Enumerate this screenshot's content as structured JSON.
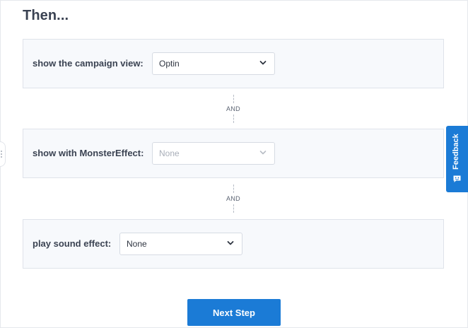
{
  "page": {
    "heading": "Then..."
  },
  "rules": [
    {
      "label": "show the campaign view:",
      "select_value": "Optin",
      "disabled": false
    },
    {
      "label": "show with MonsterEffect:",
      "select_value": "None",
      "disabled": true
    },
    {
      "label": "play sound effect:",
      "select_value": "None",
      "disabled": false
    }
  ],
  "connectors": [
    {
      "label": "AND"
    },
    {
      "label": "AND"
    }
  ],
  "actions": {
    "next_step_label": "Next Step"
  },
  "feedback": {
    "label": "Feedback",
    "icon": "smiley-chat-icon"
  },
  "colors": {
    "accent": "#1b7bd6",
    "card_bg": "#f7f9fc",
    "card_border": "#dfe3ea"
  }
}
